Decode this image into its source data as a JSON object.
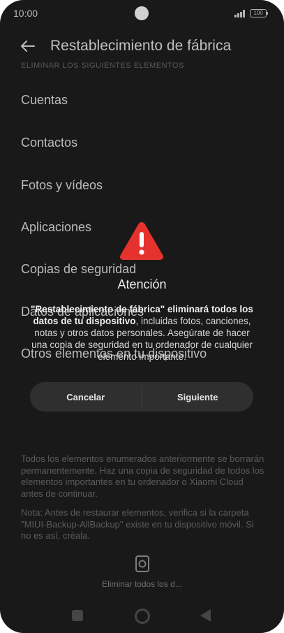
{
  "status_bar": {
    "time": "10:00",
    "battery": "100",
    "icons": [
      "camera-cutout",
      "signal-icon",
      "battery-icon"
    ]
  },
  "header": {
    "back_icon": "arrow-left-icon",
    "title": "Restablecimiento de fábrica"
  },
  "section_header": "ELIMINAR LOS SIGUIENTES ELEMENTOS",
  "items": [
    {
      "label": "Cuentas"
    },
    {
      "label": "Contactos"
    },
    {
      "label": "Fotos y vídeos"
    },
    {
      "label": "Aplicaciones"
    },
    {
      "label": "Copias de seguridad"
    },
    {
      "label": "Datos de aplicaciones"
    },
    {
      "label": "Otros elementos en tu dispositivo"
    }
  ],
  "footer": {
    "notice": "Todos los elementos enumerados anteriormente se borrarán permanentemente. Haz una copia de seguridad de todos los elementos importantes en tu ordenador o Xiaomi Cloud antes de continuar.",
    "note": "Nota: Antes de restaurar elementos, verifica si la carpeta \"MIUI-Backup-AllBackup\" existe en tu dispositivo móvil. Si no es así, créala.",
    "wipe_label": "Eliminar todos los d...",
    "wipe_icon": "phone-reset-icon"
  },
  "dialog": {
    "icon": "warning-triangle-icon",
    "title": "Atención",
    "message_bold": "\"Restablecimiento de fábrica\" eliminará todos los datos de tu dispositivo",
    "message_rest": ", incluidas fotos, canciones, notas y otros datos personales. Asegúrate de hacer una copia de seguridad en tu ordenador de cualquier elemento importante.",
    "cancel_label": "Cancelar",
    "next_label": "Siguiente"
  },
  "nav_bar": {
    "icons": [
      "recents-square-icon",
      "home-circle-icon",
      "back-triangle-icon"
    ]
  },
  "colors": {
    "background": "#1f1f1f",
    "warning_red": "#e5322d",
    "button_surface": "#2f2f2f"
  }
}
